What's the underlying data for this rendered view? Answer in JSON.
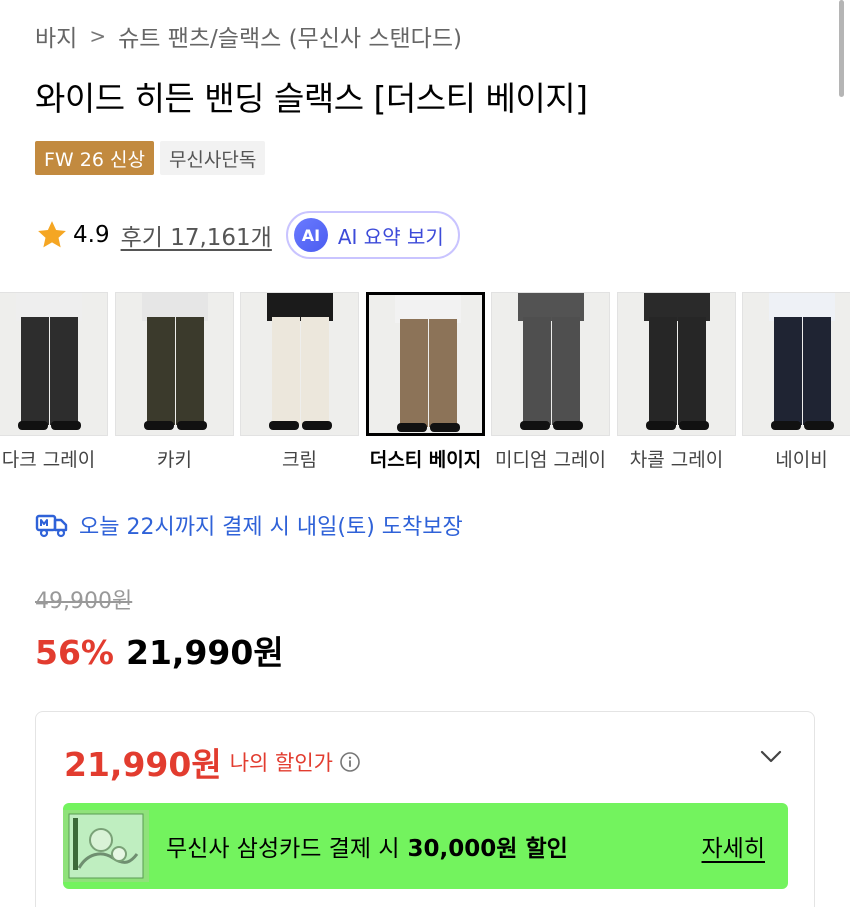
{
  "breadcrumb": {
    "level1": "바지",
    "separator": ">",
    "level2": "슈트 팬츠/슬랙스 (무신사 스탠다드)"
  },
  "product": {
    "title": "와이드 히든 밴딩 슬랙스 [더스티 베이지]",
    "badges": [
      "FW 26 신상",
      "무신사단독"
    ],
    "rating": "4.9",
    "reviews": "후기 17,161개",
    "ai_badge": "AI",
    "ai_summary": "AI 요약 보기"
  },
  "colors": [
    {
      "label": "다크 그레이",
      "top": "#eeeeee",
      "pants": "#2d2d2d",
      "selected": false
    },
    {
      "label": "카키",
      "top": "#e6e6e6",
      "pants": "#3b3a2c",
      "selected": false
    },
    {
      "label": "크림",
      "top": "#1b1b1b",
      "pants": "#ece7dc",
      "selected": false
    },
    {
      "label": "더스티 베이지",
      "top": "#f2f2f2",
      "pants": "#8c7358",
      "selected": true
    },
    {
      "label": "미디엄 그레이",
      "top": "#535353",
      "pants": "#4f4f4f",
      "selected": false
    },
    {
      "label": "차콜 그레이",
      "top": "#2a2a2a",
      "pants": "#262626",
      "selected": false
    },
    {
      "label": "네이비",
      "top": "#eef1f6",
      "pants": "#1f2433",
      "selected": false
    }
  ],
  "delivery": {
    "text": "오늘 22시까지 결제 시 내일(토) 도착보장",
    "icon": "truck-icon",
    "color": "#2f62d8"
  },
  "pricing": {
    "original": "49,900원",
    "discount": "56%",
    "sale": "21,990원",
    "my_price": "21,990원",
    "my_price_label": "나의 할인가",
    "accent": "#e23c2f"
  },
  "promo": {
    "text": "무신사 삼성카드 결제 시",
    "highlight": "30,000원 할인",
    "link": "자세히",
    "background": "#73f35e"
  }
}
